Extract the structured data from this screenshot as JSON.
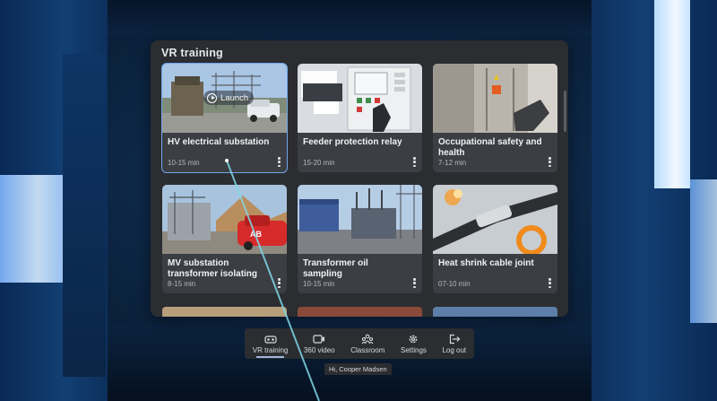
{
  "panel": {
    "title": "VR training"
  },
  "cards": [
    {
      "title": "HV electrical substation",
      "duration": "10-15 min",
      "launch_label": "Launch",
      "selected": true
    },
    {
      "title": "Feeder protection relay",
      "duration": "15-20 min"
    },
    {
      "title": "Occupational safety and health",
      "duration": "7-12 min"
    },
    {
      "title": "MV substation transformer isolating",
      "duration": "8-15 min"
    },
    {
      "title": "Transformer oil sampling",
      "duration": "10-15 min"
    },
    {
      "title": "Heat shrink cable joint",
      "duration": "07-10 min"
    }
  ],
  "nav": [
    {
      "label": "VR training",
      "icon": "vr-headset-icon",
      "active": true
    },
    {
      "label": "360 video",
      "icon": "video-360-icon"
    },
    {
      "label": "Classroom",
      "icon": "classroom-icon"
    },
    {
      "label": "Settings",
      "icon": "gear-icon"
    },
    {
      "label": "Log out",
      "icon": "logout-icon"
    }
  ],
  "greeting": "Hi, Cooper Madsen",
  "colors": {
    "panel_bg": "#2b2d31",
    "card_bg": "#3b3e43",
    "accent": "#6fa8e8",
    "laser": "#7fd6e6"
  }
}
